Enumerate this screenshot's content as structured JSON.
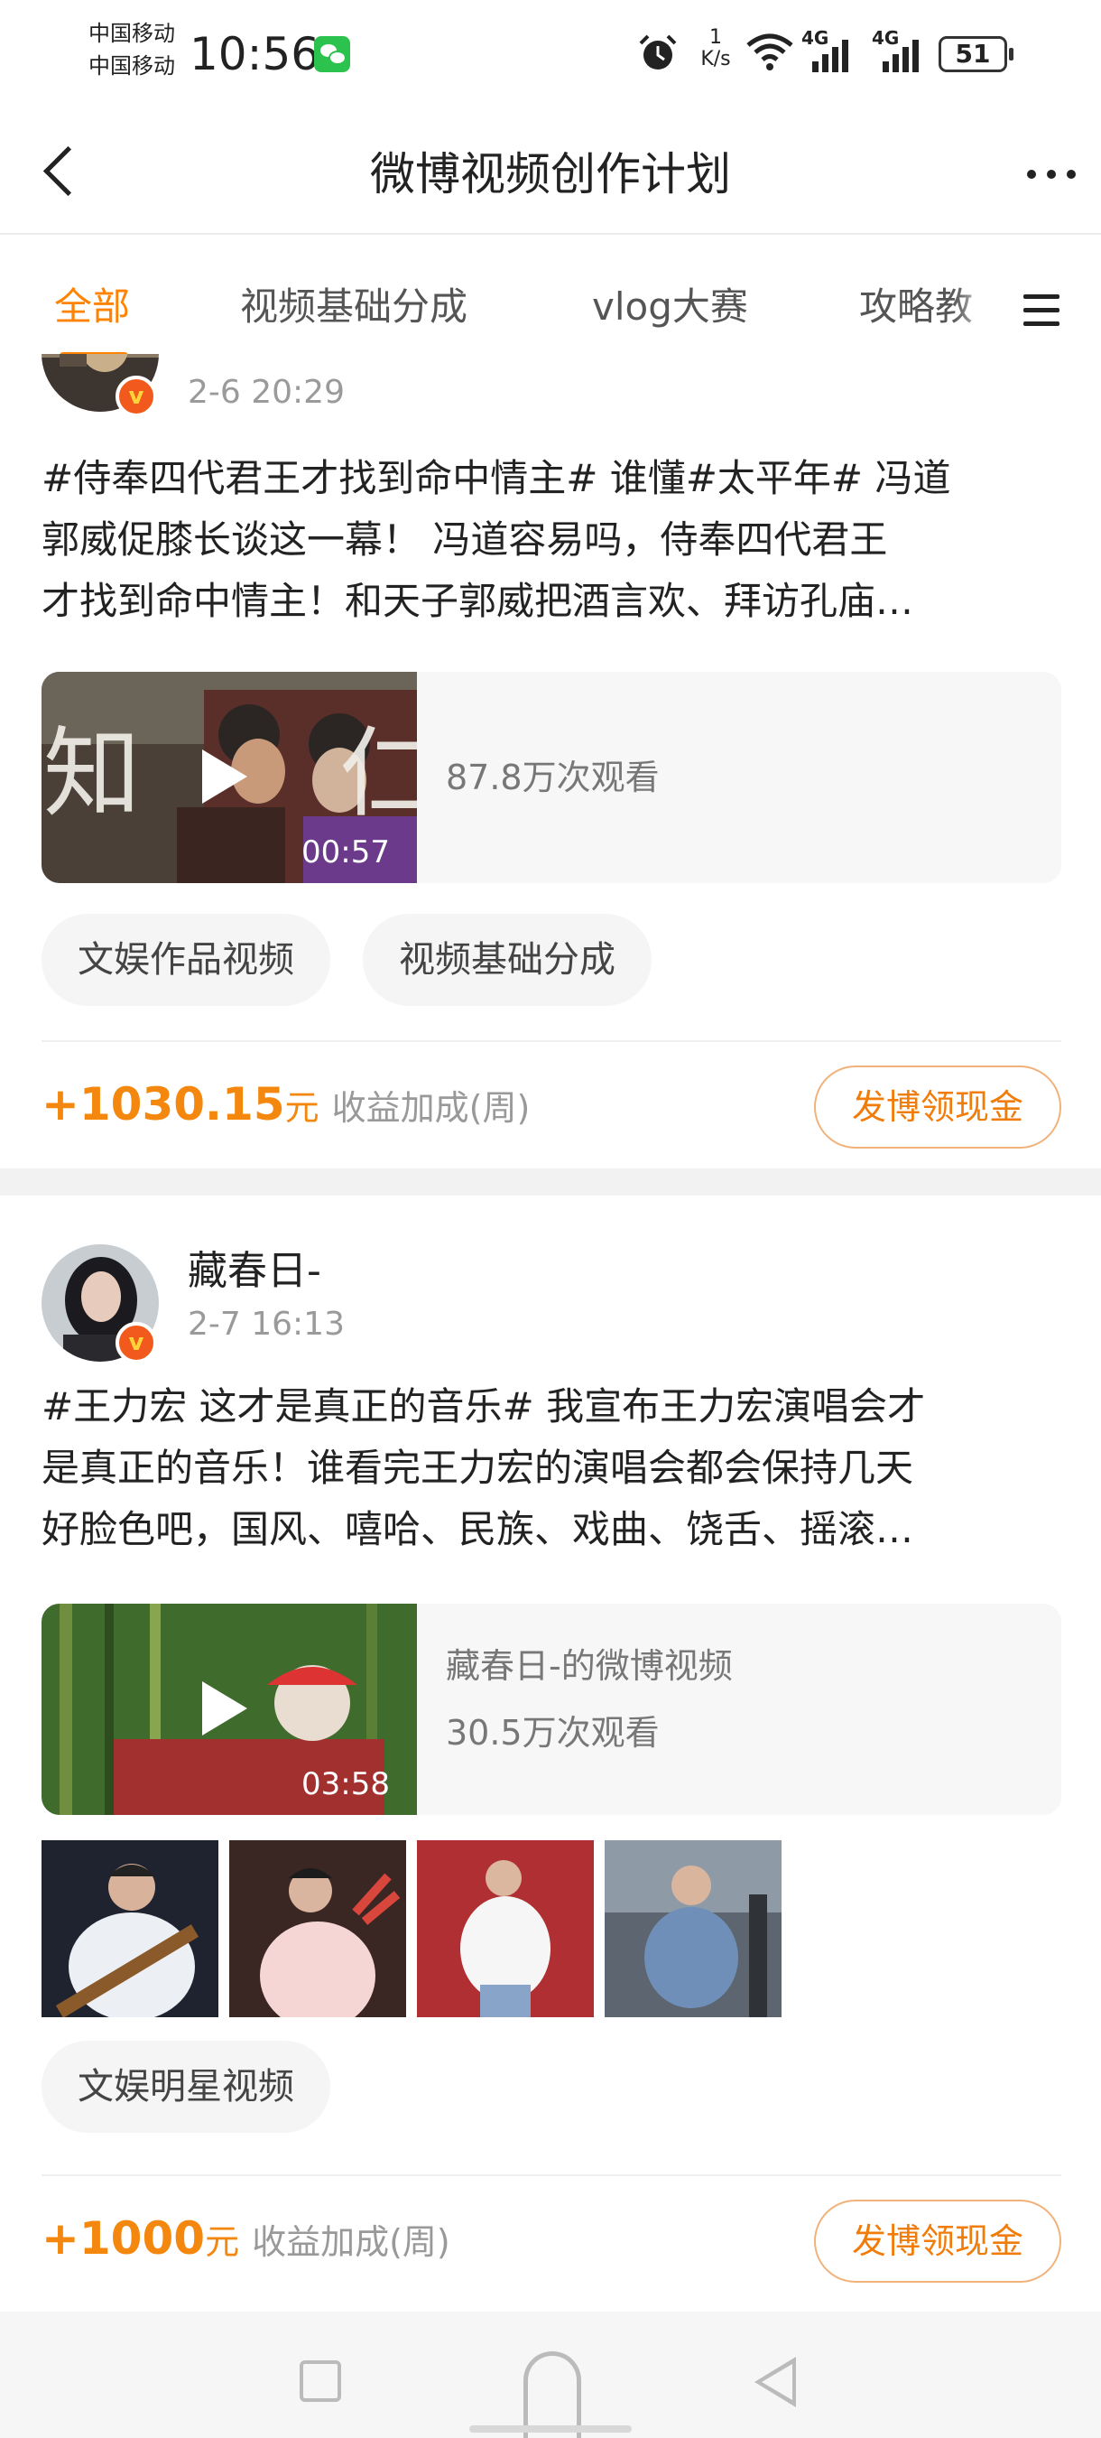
{
  "status_bar": {
    "carrier_1": "中国移动",
    "carrier_2": "中国移动",
    "time": "10:56",
    "net_speed_value": "1",
    "net_speed_unit": "K/s",
    "signal_1_label": "4G",
    "signal_2_label": "4G",
    "battery": "51",
    "icons": [
      "wechat-icon",
      "alarm-icon",
      "wifi-icon",
      "signal-icon",
      "signal-icon",
      "battery-icon"
    ]
  },
  "nav": {
    "title": "微博视频创作计划",
    "back_icon": "chevron-left-icon",
    "more_icon": "more-dots-icon"
  },
  "tabs": [
    {
      "label": "全部",
      "active": true
    },
    {
      "label": "视频基础分成",
      "active": false
    },
    {
      "label": "vlog大赛",
      "active": false
    },
    {
      "label": "攻略教",
      "active": false
    }
  ],
  "accent_color": "#ff8200",
  "posts": [
    {
      "time": "2-6 20:29",
      "text_lines": [
        "#侍奉四代君王才找到命中情主# 谁懂#太平年# 冯道",
        "郭威促膝长谈这一幕！ 冯道容易吗，侍奉四代君王",
        "才找到命中情主！和天子郭威把酒言欢、拜访孔庙…"
      ],
      "video": {
        "duration": "00:57",
        "views": "87.8万次观看",
        "thumb_text_1": "知",
        "thumb_text_2": "仁"
      },
      "tags": [
        "文娱作品视频",
        "视频基础分成"
      ],
      "reward": {
        "amount": "+1030.15",
        "unit": "元",
        "desc": "收益加成(周)"
      },
      "cash_button": "发博领现金"
    },
    {
      "username": "藏春日-",
      "time": "2-7 16:13",
      "text_lines": [
        "#王力宏 这才是真正的音乐# 我宣布王力宏演唱会才",
        "是真正的音乐！谁看完王力宏的演唱会都会保持几天",
        "好脸色吧，国风、嘻哈、民族、戏曲、饶舌、摇滚…"
      ],
      "video": {
        "title": "藏春日-的微博视频",
        "duration": "03:58",
        "views": "30.5万次观看"
      },
      "photos": [
        "photo-guitar",
        "photo-mic-red",
        "photo-white-shirt",
        "photo-denim"
      ],
      "tags": [
        "文娱明星视频"
      ],
      "reward": {
        "amount": "+1000",
        "unit": "元",
        "desc": "收益加成(周)"
      },
      "cash_button": "发博领现金"
    }
  ]
}
